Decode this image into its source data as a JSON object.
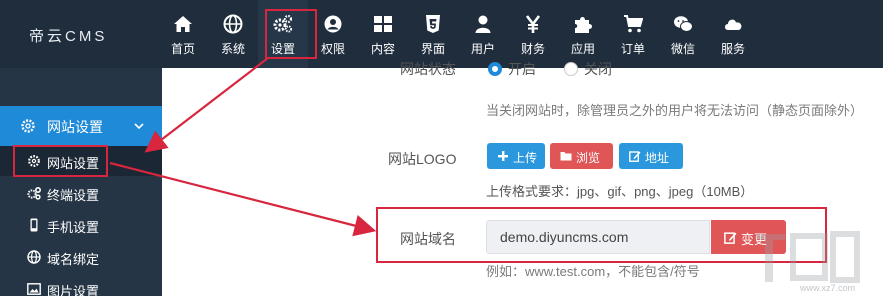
{
  "brand": "帝云CMS",
  "nav": [
    {
      "label": "首页",
      "icon": "home-icon"
    },
    {
      "label": "系统",
      "icon": "globe-icon"
    },
    {
      "label": "设置",
      "icon": "cogs-icon",
      "active": true
    },
    {
      "label": "权限",
      "icon": "user-circle-icon"
    },
    {
      "label": "内容",
      "icon": "grid-icon"
    },
    {
      "label": "界面",
      "icon": "html5-icon"
    },
    {
      "label": "用户",
      "icon": "user-icon"
    },
    {
      "label": "财务",
      "icon": "yen-icon"
    },
    {
      "label": "应用",
      "icon": "puzzle-icon"
    },
    {
      "label": "订单",
      "icon": "cart-icon"
    },
    {
      "label": "微信",
      "icon": "wechat-icon"
    },
    {
      "label": "服务",
      "icon": "cloud-icon"
    }
  ],
  "sidebar": {
    "group": "网站设置",
    "items": [
      {
        "label": "网站设置",
        "icon": "gear-icon",
        "active": true
      },
      {
        "label": "终端设置",
        "icon": "cogs-icon"
      },
      {
        "label": "手机设置",
        "icon": "mobile-icon"
      },
      {
        "label": "域名绑定",
        "icon": "globe-icon"
      },
      {
        "label": "图片设置",
        "icon": "image-icon"
      }
    ]
  },
  "form": {
    "status_label": "网站状态",
    "status_options": [
      "开启",
      "关闭"
    ],
    "status_hint": "当关闭网站时，除管理员之外的用户将无法访问（静态页面除外）",
    "logo_label": "网站LOGO",
    "upload_btn": "上传",
    "browse_btn": "浏览",
    "address_btn": "地址",
    "logo_hint": "上传格式要求：jpg、gif、png、jpeg（10MB）",
    "domain_label": "网站域名",
    "domain_value": "demo.diyuncms.com",
    "change_btn": "变更",
    "domain_hint": "例如：www.test.com，不能包含/符号"
  },
  "colors": {
    "topbar": "#1f2d3d",
    "sidebar": "#263545",
    "accent": "#1e8ad8",
    "danger": "#e05556",
    "annotation": "#d7263d"
  },
  "watermark": {
    "site": "www.xz7.com"
  }
}
